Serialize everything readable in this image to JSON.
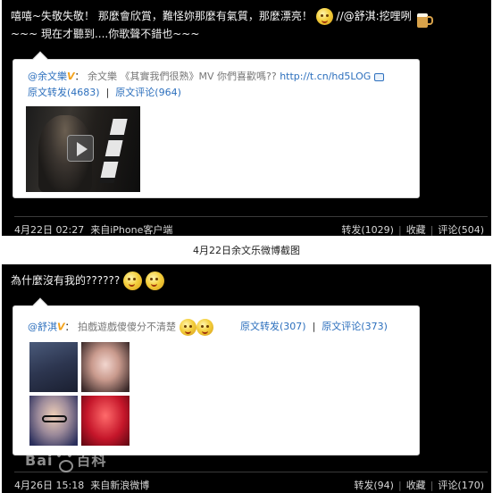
{
  "post1": {
    "text_line1": "嘻嘻~失敬失敬！ 那麼會欣賞，難怪妳那麼有氣質，那麼漂亮！",
    "mention_suffix": "//@舒淇:挖哩咧",
    "text_line2": "~~~ 現在才聽到....你歌聲不錯也~~~",
    "quote": {
      "author": "@余文樂",
      "verified": "V",
      "colon": "：",
      "text": "余文樂 《其實我們很熟》MV 你們喜歡嗎??",
      "link": "http://t.cn/hd5LOG",
      "repost_label": "原文转发",
      "repost_count": "(4683)",
      "comment_label": "原文评论",
      "comment_count": "(964)"
    },
    "footer": {
      "date": "4月22日",
      "time": "02:27",
      "source": "来自iPhone客户端",
      "repost": "转发(1029)",
      "favorite": "收藏",
      "comment": "评论(504)"
    }
  },
  "caption": "4月22日余文乐微博截图",
  "post2": {
    "text": "為什麼沒有我的??????",
    "quote": {
      "author": "@舒淇",
      "verified": "V",
      "colon": "：",
      "text": "拍戲遊戲傻傻分不清楚",
      "repost_label": "原文转发",
      "repost_count": "(307)",
      "comment_label": "原文评论",
      "comment_count": "(373)"
    },
    "footer": {
      "date": "4月26日",
      "time": "15:18",
      "source": "来自新浪微博",
      "repost": "转发(94)",
      "favorite": "收藏",
      "comment": "评论(170)"
    }
  },
  "watermark": {
    "text_left": "Bai",
    "text_right": "百科"
  }
}
